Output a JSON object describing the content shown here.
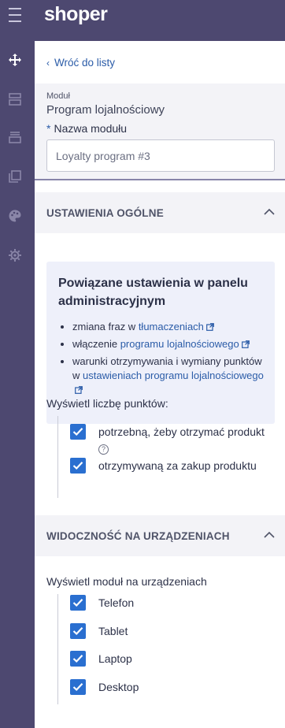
{
  "app": {
    "logo": "shoper"
  },
  "sidebar": {
    "icons": [
      "menu-icon",
      "move-icon",
      "layout-icon",
      "stack-icon",
      "copy-icon",
      "palette-icon",
      "gear-icon"
    ]
  },
  "nav": {
    "back_label": "Wróć do listy"
  },
  "module": {
    "small_label": "Moduł",
    "name": "Program lojalnościowy",
    "field_required_mark": "*",
    "field_label": "Nazwa modułu",
    "field_value": "Loyalty program #3"
  },
  "general": {
    "section_title": "USTAWIENIA OGÓLNE",
    "info_title": "Powiązane ustawienia w panelu administracyjnym",
    "info_items": [
      {
        "prefix": "zmiana fraz w ",
        "link": "tłumaczeniach"
      },
      {
        "prefix": "włączenie ",
        "link": "programu lojalnościowego"
      },
      {
        "prefix": "warunki otrzymywania i wymiany punktów w ",
        "link": "ustawieniach programu lojalnościowego"
      }
    ],
    "points_label": "Wyświetl liczbę punktów:",
    "points_options": [
      {
        "label": "potrzebną, żeby otrzymać produkt",
        "checked": true,
        "help": "?"
      },
      {
        "label": "otrzymywaną za zakup produktu",
        "checked": true
      }
    ]
  },
  "devices": {
    "section_title": "WIDOCZNOŚĆ NA URZĄDZENIACH",
    "label": "Wyświetl moduł na urządzeniach",
    "options": [
      {
        "label": "Telefon",
        "checked": true
      },
      {
        "label": "Tablet",
        "checked": true
      },
      {
        "label": "Laptop",
        "checked": true
      },
      {
        "label": "Desktop",
        "checked": true
      }
    ]
  },
  "colors": {
    "sidebar": "#4d4870",
    "accent": "#2a6fd0",
    "link": "#2b5ca8"
  }
}
